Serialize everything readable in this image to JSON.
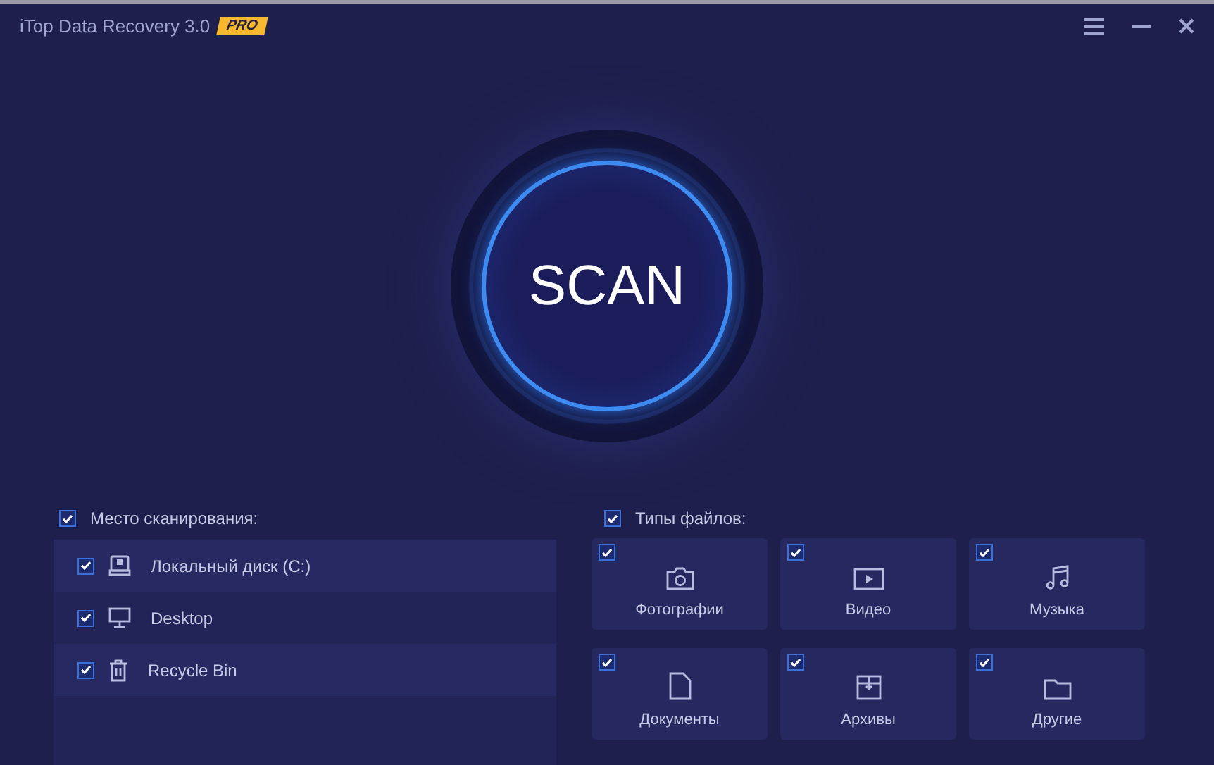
{
  "window": {
    "title": "iTop Data Recovery 3.0",
    "badge": "PRO"
  },
  "scan_button": {
    "label": "SCAN"
  },
  "scan_locations": {
    "label": "Место сканирования:",
    "checked": true,
    "items": [
      {
        "kind": "drive",
        "label": "Локальный диск (C:)",
        "checked": true
      },
      {
        "kind": "desktop",
        "label": "Desktop",
        "checked": true
      },
      {
        "kind": "trash",
        "label": "Recycle Bin",
        "checked": true
      }
    ]
  },
  "file_types": {
    "label": "Типы файлов:",
    "checked": true,
    "items": [
      {
        "kind": "photo",
        "label": "Фотографии",
        "checked": true
      },
      {
        "kind": "video",
        "label": "Видео",
        "checked": true
      },
      {
        "kind": "music",
        "label": "Музыка",
        "checked": true
      },
      {
        "kind": "document",
        "label": "Документы",
        "checked": true
      },
      {
        "kind": "archive",
        "label": "Архивы",
        "checked": true
      },
      {
        "kind": "other",
        "label": "Другие",
        "checked": true
      }
    ]
  }
}
